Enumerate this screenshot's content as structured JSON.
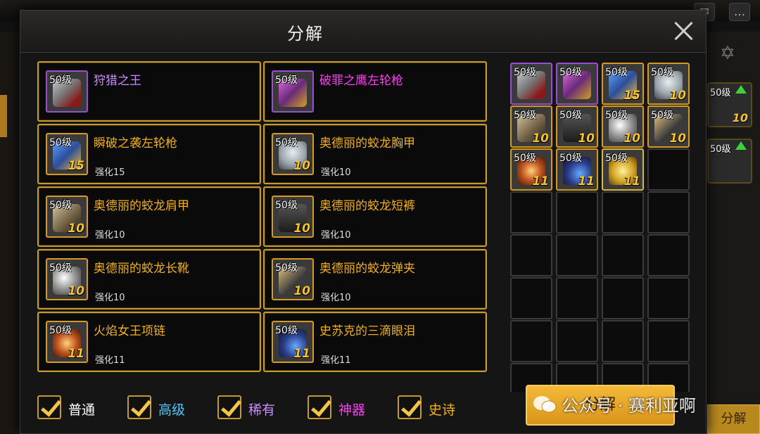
{
  "dialog": {
    "title": "分解",
    "close_label": "×"
  },
  "items": [
    {
      "name": "狩猎之王",
      "name_color": "#c98cff",
      "level": "50级",
      "sub": "",
      "num": "",
      "frame": "purple",
      "art": "art-gun"
    },
    {
      "name": "破罪之鹰左轮枪",
      "name_color": "#ff3df5",
      "level": "50级",
      "sub": "",
      "num": "",
      "frame": "purple",
      "art": "art-gun2"
    },
    {
      "name": "瞬破之袭左轮枪",
      "name_color": "#f2b01e",
      "level": "50级",
      "sub": "强化15",
      "num": "15",
      "frame": "orange",
      "art": "art-gun3"
    },
    {
      "name": "奥德丽的蛟龙胸甲",
      "name_color": "#f2b01e",
      "level": "50级",
      "sub": "强化10",
      "num": "10",
      "frame": "orange",
      "art": "art-armor"
    },
    {
      "name": "奥德丽的蛟龙肩甲",
      "name_color": "#f2b01e",
      "level": "50级",
      "sub": "强化10",
      "num": "10",
      "frame": "orange",
      "art": "art-shoulder"
    },
    {
      "name": "奥德丽的蛟龙短裤",
      "name_color": "#f2b01e",
      "level": "50级",
      "sub": "强化10",
      "num": "10",
      "frame": "orange",
      "art": "art-pants"
    },
    {
      "name": "奥德丽的蛟龙长靴",
      "name_color": "#f2b01e",
      "level": "50级",
      "sub": "强化10",
      "num": "10",
      "frame": "orange",
      "art": "art-boots"
    },
    {
      "name": "奥德丽的蛟龙弹夹",
      "name_color": "#f2b01e",
      "level": "50级",
      "sub": "强化10",
      "num": "10",
      "frame": "orange",
      "art": "art-mag"
    },
    {
      "name": "火焰女王项链",
      "name_color": "#f2b01e",
      "level": "50级",
      "sub": "强化11",
      "num": "11",
      "frame": "orange",
      "art": "art-neck"
    },
    {
      "name": "史苏克的三滴眼泪",
      "name_color": "#f2b01e",
      "level": "50级",
      "sub": "强化11",
      "num": "11",
      "frame": "orange",
      "art": "art-tear"
    }
  ],
  "slots": [
    {
      "level": "50级",
      "num": "",
      "frame": "purple",
      "art": "art-gun"
    },
    {
      "level": "50级",
      "num": "",
      "frame": "purple",
      "art": "art-gun2"
    },
    {
      "level": "50级",
      "num": "15",
      "frame": "orange",
      "art": "art-gun3"
    },
    {
      "level": "50级",
      "num": "10",
      "frame": "orange",
      "art": "art-armor"
    },
    {
      "level": "50级",
      "num": "10",
      "frame": "orange",
      "art": "art-shoulder"
    },
    {
      "level": "50级",
      "num": "10",
      "frame": "orange",
      "art": "art-pants"
    },
    {
      "level": "50级",
      "num": "10",
      "frame": "orange",
      "art": "art-boots"
    },
    {
      "level": "50级",
      "num": "10",
      "frame": "orange",
      "art": "art-mag"
    },
    {
      "level": "50级",
      "num": "11",
      "frame": "orange",
      "art": "art-neck"
    },
    {
      "level": "50级",
      "num": "11",
      "frame": "orange",
      "art": "art-tear"
    },
    {
      "level": "50级",
      "num": "11",
      "frame": "gold",
      "art": "art-gold"
    },
    {
      "empty": true
    },
    {
      "empty": true
    },
    {
      "empty": true
    },
    {
      "empty": true
    },
    {
      "empty": true
    },
    {
      "empty": true
    },
    {
      "empty": true
    },
    {
      "empty": true
    },
    {
      "empty": true
    },
    {
      "empty": true
    },
    {
      "empty": true
    },
    {
      "empty": true
    },
    {
      "empty": true
    },
    {
      "empty": true
    },
    {
      "empty": true
    },
    {
      "empty": true
    },
    {
      "empty": true
    },
    {
      "empty": true
    },
    {
      "empty": true
    },
    {
      "empty": true
    },
    {
      "empty": true
    },
    {
      "empty": true
    },
    {
      "empty": true
    },
    {
      "empty": true
    },
    {
      "empty": true
    }
  ],
  "filters": [
    {
      "label": "普通",
      "color": "#ffffff",
      "checked": true
    },
    {
      "label": "高级",
      "color": "#4ec8ff",
      "checked": true
    },
    {
      "label": "稀有",
      "color": "#c98cff",
      "checked": true
    },
    {
      "label": "神器",
      "color": "#ff3df5",
      "checked": true
    },
    {
      "label": "史诗",
      "color": "#f2b01e",
      "checked": true
    }
  ],
  "decompose_button": "分解",
  "watermark": "公众号 · 赛利亚啊",
  "background": {
    "right_slots": [
      {
        "level": "50级",
        "num": "10"
      },
      {
        "level": "50级",
        "num": ""
      }
    ],
    "decompose_tab": "分解"
  }
}
